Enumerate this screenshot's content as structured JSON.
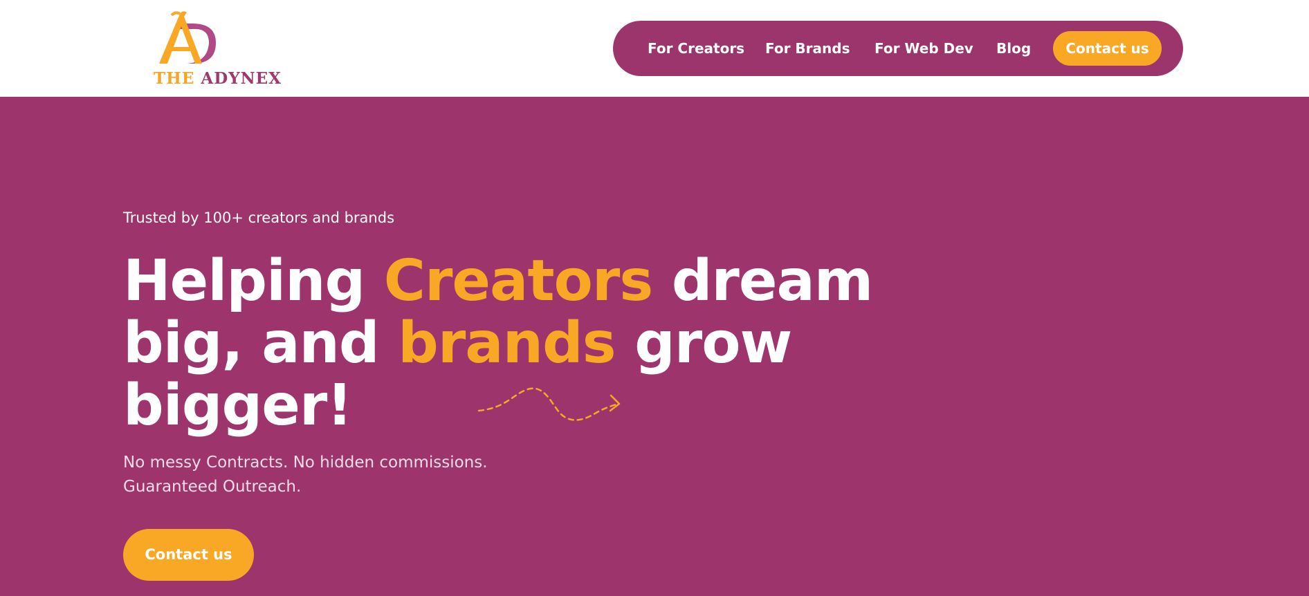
{
  "brand": {
    "logo_word1": "THE",
    "logo_word2": "ADYNEX",
    "colors": {
      "primary": "#9d356c",
      "accent": "#f9a825",
      "white": "#ffffff"
    }
  },
  "nav": {
    "items": [
      {
        "label": "For Creators"
      },
      {
        "label": "For Brands"
      },
      {
        "label": "For Web Dev"
      },
      {
        "label": "Blog"
      }
    ],
    "cta_label": "Contact us"
  },
  "hero": {
    "trusted": "Trusted by 100+ creators and brands",
    "headline": {
      "l1a": "Helping ",
      "l1b": "Creators",
      "l1c": " dream",
      "l2a": "big, and ",
      "l2b": "brands",
      "l2c": " grow",
      "l3": "bigger!"
    },
    "sub_line1": "No messy Contracts. No hidden commissions.",
    "sub_line2": "Guaranteed Outreach.",
    "cta_label": "Contact us",
    "decoration": "dashed-arrow-icon"
  }
}
